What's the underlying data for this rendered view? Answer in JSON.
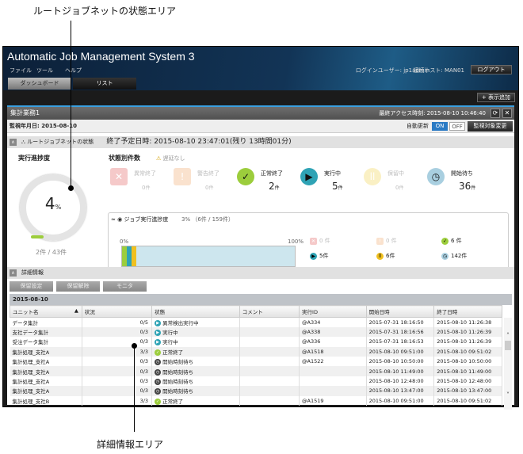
{
  "callouts": {
    "top": "ルートジョブネットの状態エリア",
    "bottom": "詳細情報エリア"
  },
  "app": {
    "title": "Automatic Job Management System 3",
    "menu": [
      "ファイル",
      "ツール",
      "ヘルプ"
    ],
    "login_user": "ログインユーザー: jp1admin",
    "host": "接続ホスト: MAN01",
    "logout": "ログアウト",
    "tabs": [
      "ダッシュボード",
      "リスト"
    ],
    "add_view": "+ 表示追加"
  },
  "panel": {
    "title": "集計業務1",
    "last_access": "最終アクセス時刻: 2015-08-10 10:46:40",
    "monitor_date": "監視年月日: 2015-08-10",
    "auto_update": "自動更新",
    "on": "ON",
    "off": "OFF",
    "change_target": "監視対象変更"
  },
  "root": {
    "header": "ルートジョブネットの状態",
    "end_time": "終了予定日時: 2015-08-10 23:47:01(残り 13時間01分)",
    "progress_title": "実行進捗度",
    "progress_pct": "4",
    "pct_unit": "%",
    "progress_value": 0.04,
    "progress_count": "2件 / 43件",
    "status_title": "状態別件数",
    "delay": "遅延なし",
    "statuses": [
      {
        "label": "異常終了",
        "count": "0",
        "unit": "件",
        "color": "#e05050",
        "icon": "x-icon"
      },
      {
        "label": "警告終了",
        "count": "0",
        "unit": "件",
        "color": "#f0a060",
        "icon": "warning-icon"
      },
      {
        "label": "正常終了",
        "count": "2",
        "unit": "件",
        "color": "#9ccd3c",
        "icon": "check-icon"
      },
      {
        "label": "実行中",
        "count": "5",
        "unit": "件",
        "color": "#2fa3b5",
        "icon": "play-icon"
      },
      {
        "label": "保留中",
        "count": "0",
        "unit": "件",
        "color": "#f0d040",
        "icon": "pause-icon"
      },
      {
        "label": "開始待ち",
        "count": "36",
        "unit": "件",
        "color": "#a9cfe0",
        "icon": "clock-icon"
      }
    ],
    "job": {
      "title": "ジョブ実行進捗度",
      "summary": "3% （6件 / 159件）",
      "min": "0%",
      "max": "100%",
      "counts": [
        "0 件",
        "0 件",
        "6 件",
        "5件",
        "6件",
        "142件"
      ]
    }
  },
  "details": {
    "header": "詳細情報",
    "buttons": [
      "保留設定",
      "保留解除",
      "モニタ"
    ],
    "date": "2015-08-10",
    "columns": [
      "ユニット名",
      "状況",
      "状態",
      "コメント",
      "実行ID",
      "開始日時",
      "終了日時"
    ],
    "sort_indicator": "▲",
    "rows": [
      [
        "データ集計",
        "0/5",
        "異常検出実行中",
        "",
        "@A334",
        "2015-07-31 18:16:50",
        "2015-08-10 11:26:38",
        "run"
      ],
      [
        "支社データ集計",
        "0/3",
        "実行中",
        "",
        "@A338",
        "2015-07-31 18:16:56",
        "2015-08-10 11:26:39",
        "run"
      ],
      [
        "受注データ集計",
        "0/3",
        "実行中",
        "",
        "@A336",
        "2015-07-31 18:16:53",
        "2015-08-10 11:26:39",
        "run"
      ],
      [
        "集計処理_支社A",
        "3/3",
        "正常終了",
        "",
        "@A1518",
        "2015-08-10 09:51:00",
        "2015-08-10 09:51:02",
        "ok"
      ],
      [
        "集計処理_支社A",
        "0/3",
        "開始時刻待ち",
        "",
        "@A1522",
        "2015-08-10 10:50:00",
        "2015-08-10 10:50:00",
        "wait"
      ],
      [
        "集計処理_支社A",
        "0/3",
        "開始時刻待ち",
        "",
        "",
        "2015-08-10 11:49:00",
        "2015-08-10 11:49:00",
        "wait"
      ],
      [
        "集計処理_支社A",
        "0/3",
        "開始時刻待ち",
        "",
        "",
        "2015-08-10 12:48:00",
        "2015-08-10 12:48:00",
        "wait"
      ],
      [
        "集計処理_支社A",
        "0/3",
        "開始時刻待ち",
        "",
        "",
        "2015-08-10 13:47:00",
        "2015-08-10 13:47:00",
        "wait"
      ],
      [
        "集計処理_支社B",
        "3/3",
        "正常終了",
        "",
        "@A1519",
        "2015-08-10 09:51:00",
        "2015-08-10 09:51:02",
        "ok"
      ]
    ]
  }
}
